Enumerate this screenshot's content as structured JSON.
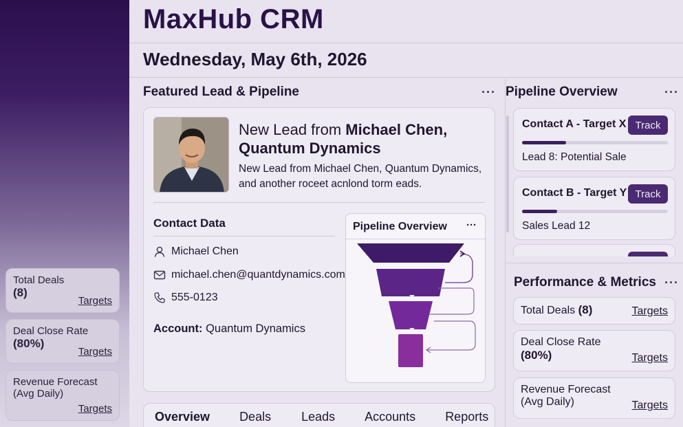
{
  "app": {
    "title": "MaxHub CRM",
    "date": "Wednesday, May 6th, 2026"
  },
  "sidebar": {
    "cards": [
      {
        "label": "Total Deals",
        "value": "(8)",
        "link": "Targets"
      },
      {
        "label": "Deal Close Rate",
        "value": "(80%)",
        "link": "Targets"
      },
      {
        "label": "Revenue Forecast",
        "label2": "(Avg Daily)",
        "link": "Targets"
      }
    ]
  },
  "featured": {
    "section_title": "Featured Lead & Pipeline",
    "menu": "···",
    "headline_prefix": "New Lead from ",
    "headline_bold": "Michael Chen, Quantum Dynamics",
    "description": "New Lead from Michael Chen, Quantum Dynamics, and another roceet acnlond torm eads.",
    "contact": {
      "title": "Contact Data",
      "name": "Michael Chen",
      "email": "michael.chen@quantdynamics.com",
      "phone": "555-0123",
      "account_label": "Account:",
      "account_value": "Quantum Dynamics"
    },
    "funnel": {
      "title": "Pipeline Overview",
      "menu": "···"
    }
  },
  "tabs": [
    "Overview",
    "Deals",
    "Leads",
    "Accounts",
    "Reports"
  ],
  "pipeline": {
    "title": "Pipeline Overview",
    "menu": "···",
    "items": [
      {
        "title": "Contact A - Target X",
        "button": "Track",
        "progress": 0.3,
        "subtitle": "Lead 8: Potential Sale"
      },
      {
        "title": "Contact B - Target Y",
        "button": "Track",
        "progress": 0.24,
        "subtitle": "Sales Lead 12"
      }
    ]
  },
  "performance": {
    "title": "Performance & Metrics",
    "menu": "···",
    "cards": [
      {
        "label": "Total Deals",
        "value": "(8)",
        "link": "Targets"
      },
      {
        "label": "Deal Close Rate",
        "value": "(80%)",
        "link": "Targets"
      },
      {
        "label": "Revenue Forecast",
        "label2": "(Avg Daily)",
        "link": "Targets"
      }
    ]
  },
  "colors": {
    "brand_dark": "#2a1248",
    "funnel_top": "#3e1a68",
    "funnel_mid": "#5a2587",
    "funnel_low": "#73299a",
    "funnel_bottom": "#8a2e9e"
  },
  "icons": [
    "person-icon",
    "mail-icon",
    "phone-icon",
    "ellipsis-icon",
    "arrow-loop-icon"
  ]
}
